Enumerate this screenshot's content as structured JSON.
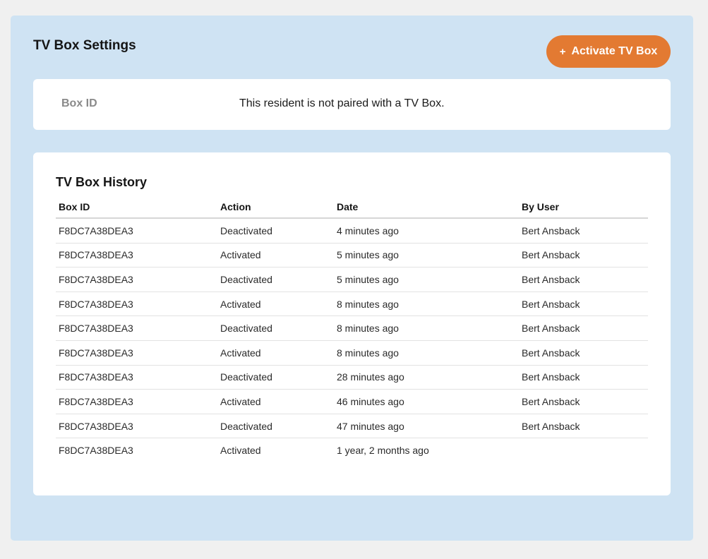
{
  "panel": {
    "title": "TV Box Settings",
    "activate_button": {
      "icon": "+",
      "label": "Activate TV Box"
    }
  },
  "box_id": {
    "label": "Box ID",
    "value": "This resident is not paired with a TV Box."
  },
  "history": {
    "title": "TV Box History",
    "columns": [
      "Box ID",
      "Action",
      "Date",
      "By User"
    ],
    "rows": [
      {
        "box_id": "F8DC7A38DEA3",
        "action": "Deactivated",
        "date": "4 minutes ago",
        "user": "Bert Ansback"
      },
      {
        "box_id": "F8DC7A38DEA3",
        "action": "Activated",
        "date": "5 minutes ago",
        "user": "Bert Ansback"
      },
      {
        "box_id": "F8DC7A38DEA3",
        "action": "Deactivated",
        "date": "5 minutes ago",
        "user": "Bert Ansback"
      },
      {
        "box_id": "F8DC7A38DEA3",
        "action": "Activated",
        "date": "8 minutes ago",
        "user": "Bert Ansback"
      },
      {
        "box_id": "F8DC7A38DEA3",
        "action": "Deactivated",
        "date": "8 minutes ago",
        "user": "Bert Ansback"
      },
      {
        "box_id": "F8DC7A38DEA3",
        "action": "Activated",
        "date": "8 minutes ago",
        "user": "Bert Ansback"
      },
      {
        "box_id": "F8DC7A38DEA3",
        "action": "Deactivated",
        "date": "28 minutes ago",
        "user": "Bert Ansback"
      },
      {
        "box_id": "F8DC7A38DEA3",
        "action": "Activated",
        "date": "46 minutes ago",
        "user": "Bert Ansback"
      },
      {
        "box_id": "F8DC7A38DEA3",
        "action": "Deactivated",
        "date": "47 minutes ago",
        "user": "Bert Ansback"
      },
      {
        "box_id": "F8DC7A38DEA3",
        "action": "Activated",
        "date": "1 year, 2 months ago",
        "user": ""
      }
    ]
  },
  "colors": {
    "page_background": "#f0f0f0",
    "panel_background": "#cfe3f3",
    "card_background": "#ffffff",
    "accent": "#e37a32",
    "muted_label": "#8a8a8a"
  }
}
